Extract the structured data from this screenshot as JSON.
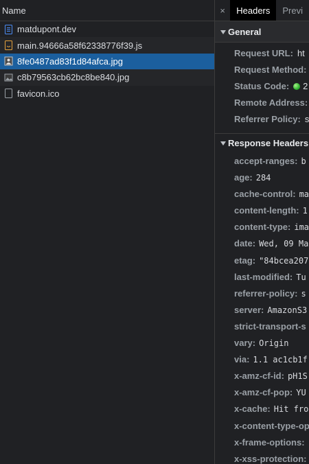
{
  "left": {
    "header": "Name",
    "files": [
      {
        "name": "matdupont.dev",
        "icon": "document-icon",
        "color": "#4c8df6"
      },
      {
        "name": "main.94666a58f62338776f39.js",
        "icon": "script-icon",
        "color": "#e8a33c"
      },
      {
        "name": "8fe0487ad83f1d84afca.jpg",
        "icon": "image-icon",
        "color": "#c4c4c4",
        "selected": true
      },
      {
        "name": "c8b79563cb62bc8be840.jpg",
        "icon": "image-icon",
        "color": "#9aa0a6"
      },
      {
        "name": "favicon.ico",
        "icon": "blank-file-icon",
        "color": "#9aa0a6"
      }
    ]
  },
  "right": {
    "close": "×",
    "tabs": [
      "Headers",
      "Previ"
    ],
    "general": {
      "title": "General",
      "rows": [
        {
          "k": "Request URL:",
          "v": "ht"
        },
        {
          "k": "Request Method:",
          "v": ""
        },
        {
          "k": "Status Code:",
          "v": "2"
        },
        {
          "k": "Remote Address:",
          "v": ""
        },
        {
          "k": "Referrer Policy:",
          "v": "s"
        }
      ]
    },
    "response": {
      "title": "Response Headers",
      "rows": [
        {
          "k": "accept-ranges:",
          "v": "b"
        },
        {
          "k": "age:",
          "v": "284"
        },
        {
          "k": "cache-control:",
          "v": "ma"
        },
        {
          "k": "content-length:",
          "v": "1"
        },
        {
          "k": "content-type:",
          "v": "ima"
        },
        {
          "k": "date:",
          "v": "Wed, 09 Ma"
        },
        {
          "k": "etag:",
          "v": "\"84bcea207"
        },
        {
          "k": "last-modified:",
          "v": "Tu"
        },
        {
          "k": "referrer-policy:",
          "v": "s"
        },
        {
          "k": "server:",
          "v": "AmazonS3"
        },
        {
          "k": "strict-transport-s",
          "v": ""
        },
        {
          "k": "vary:",
          "v": "Origin"
        },
        {
          "k": "via:",
          "v": "1.1 ac1cb1f"
        },
        {
          "k": "x-amz-cf-id:",
          "v": "pH1S"
        },
        {
          "k": "x-amz-cf-pop:",
          "v": "YU"
        },
        {
          "k": "x-cache:",
          "v": "Hit fro"
        },
        {
          "k": "x-content-type-op",
          "v": ""
        },
        {
          "k": "x-frame-options:",
          "v": ""
        },
        {
          "k": "x-xss-protection:",
          "v": ""
        }
      ]
    }
  }
}
